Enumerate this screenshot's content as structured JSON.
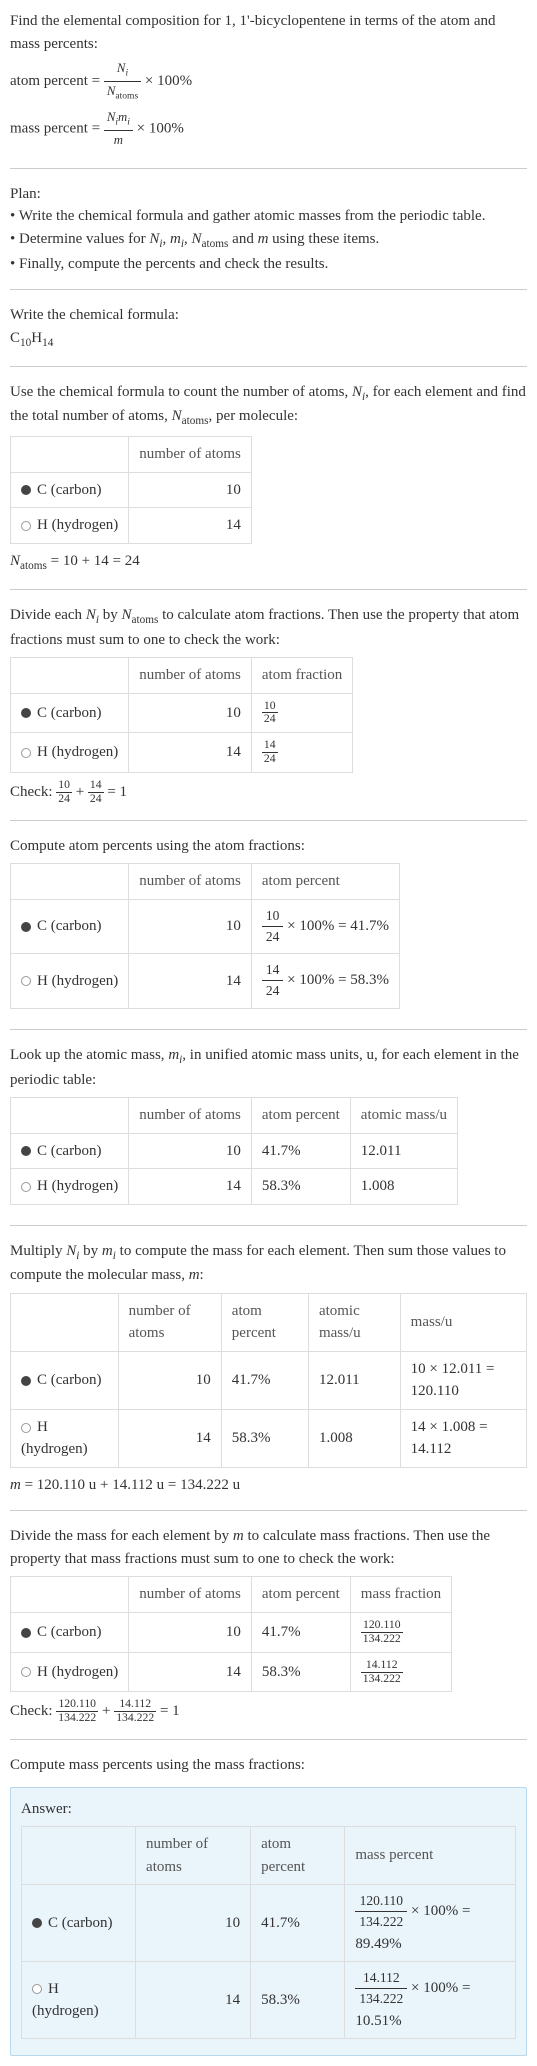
{
  "intro": {
    "line1": "Find the elemental composition for 1, 1'-bicyclopentene in terms of the atom and mass percents:",
    "atom_label": "atom percent = ",
    "atom_num": "N",
    "atom_num_sub": "i",
    "atom_den": "N",
    "atom_den_sub": "atoms",
    "times100a": " × 100%",
    "mass_label": "mass percent = ",
    "mass_num": "N_i m_i",
    "mass_den": "m",
    "times100b": " × 100%"
  },
  "plan": {
    "header": "Plan:",
    "b1": "• Write the chemical formula and gather atomic masses from the periodic table.",
    "b2": "• Determine values for N_i, m_i, N_atoms and m using these items.",
    "b3": "• Finally, compute the percents and check the results."
  },
  "formula": {
    "line": "Write the chemical formula:",
    "value_pre": "C",
    "c_sub": "10",
    "h": "H",
    "h_sub": "14"
  },
  "count": {
    "line": "Use the chemical formula to count the number of atoms, N_i, for each element and find the total number of atoms, N_atoms, per molecule:",
    "hdr_atoms": "number of atoms",
    "c_label": "C (carbon)",
    "c_n": "10",
    "h_label": "H (hydrogen)",
    "h_n": "14",
    "natoms_eq": "N_atoms = 10 + 14 = 24"
  },
  "atomfrac": {
    "line": "Divide each N_i by N_atoms to calculate atom fractions. Then use the property that atom fractions must sum to one to check the work:",
    "hdr_atoms": "number of atoms",
    "hdr_frac": "atom fraction",
    "c_n": "10",
    "c_num": "10",
    "c_den": "24",
    "h_n": "14",
    "h_num": "14",
    "h_den": "24",
    "check": "Check: ",
    "check_eq": " = 1"
  },
  "atompct": {
    "line": "Compute atom percents using the atom fractions:",
    "hdr_atoms": "number of atoms",
    "hdr_pct": "atom percent",
    "c_n": "10",
    "c_num": "10",
    "c_den": "24",
    "c_res": " × 100% = 41.7%",
    "h_n": "14",
    "h_num": "14",
    "h_den": "24",
    "h_res": " × 100% = 58.3%"
  },
  "atomicmass": {
    "line": "Look up the atomic mass, m_i, in unified atomic mass units, u, for each element in the periodic table:",
    "hdr_atoms": "number of atoms",
    "hdr_pct": "atom percent",
    "hdr_mass": "atomic mass/u",
    "c_n": "10",
    "c_pct": "41.7%",
    "c_mass": "12.011",
    "h_n": "14",
    "h_pct": "58.3%",
    "h_mass": "1.008"
  },
  "molmass": {
    "line": "Multiply N_i by m_i to compute the mass for each element. Then sum those values to compute the molecular mass, m:",
    "hdr_atoms": "number of atoms",
    "hdr_pct": "atom percent",
    "hdr_amass": "atomic mass/u",
    "hdr_mass": "mass/u",
    "c_n": "10",
    "c_pct": "41.7%",
    "c_amass": "12.011",
    "c_mass": "10 × 12.011 = 120.110",
    "h_n": "14",
    "h_pct": "58.3%",
    "h_amass": "1.008",
    "h_mass": "14 × 1.008 = 14.112",
    "m_eq": "m = 120.110 u + 14.112 u = 134.222 u"
  },
  "massfrac": {
    "line": "Divide the mass for each element by m to calculate mass fractions. Then use the property that mass fractions must sum to one to check the work:",
    "hdr_atoms": "number of atoms",
    "hdr_pct": "atom percent",
    "hdr_mfrac": "mass fraction",
    "c_n": "10",
    "c_pct": "41.7%",
    "c_num": "120.110",
    "c_den": "134.222",
    "h_n": "14",
    "h_pct": "58.3%",
    "h_num": "14.112",
    "h_den": "134.222",
    "check": "Check: ",
    "check_eq": " = 1"
  },
  "masspct": {
    "line": "Compute mass percents using the mass fractions:"
  },
  "answer": {
    "label": "Answer:",
    "hdr_atoms": "number of atoms",
    "hdr_pct": "atom percent",
    "hdr_mpct": "mass percent",
    "c_n": "10",
    "c_pct": "41.7%",
    "c_num": "120.110",
    "c_den": "134.222",
    "c_res": " × 100% = 89.49%",
    "h_n": "14",
    "h_pct": "58.3%",
    "h_num": "14.112",
    "h_den": "134.222",
    "h_res": " × 100% = 10.51%"
  },
  "chart_data": {
    "type": "table",
    "title": "Elemental composition of 1,1'-bicyclopentene (C10H14)",
    "elements": [
      {
        "symbol": "C",
        "name": "carbon",
        "atoms": 10,
        "atom_fraction": 0.4167,
        "atom_percent": 41.7,
        "atomic_mass_u": 12.011,
        "mass_u": 120.11,
        "mass_fraction": 0.8949,
        "mass_percent": 89.49
      },
      {
        "symbol": "H",
        "name": "hydrogen",
        "atoms": 14,
        "atom_fraction": 0.5833,
        "atom_percent": 58.3,
        "atomic_mass_u": 1.008,
        "mass_u": 14.112,
        "mass_fraction": 0.1051,
        "mass_percent": 10.51
      }
    ],
    "N_atoms": 24,
    "molecular_mass_u": 134.222
  }
}
